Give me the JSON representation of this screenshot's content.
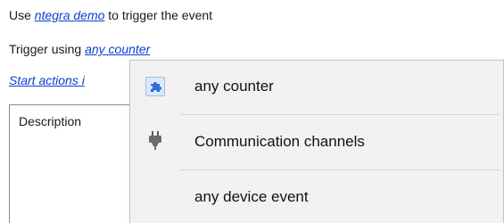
{
  "line1": {
    "prefix": "Use",
    "link": "ntegra demo",
    "suffix": "to trigger the event"
  },
  "line2": {
    "prefix": "Trigger using",
    "link": "any counter"
  },
  "line3": {
    "link": "Start actions i"
  },
  "description": {
    "label": "Description"
  },
  "menu": {
    "items": [
      {
        "label": "any counter",
        "icon": "puzzle-icon"
      },
      {
        "label": "Communication channels",
        "icon": "plug-icon"
      },
      {
        "label": "any device event",
        "icon": ""
      }
    ]
  },
  "colors": {
    "link": "#0b3ecf",
    "popup_bg": "#f2f2f2",
    "icon_highlight": "#dbe9fb",
    "puzzle": "#2f6fd6"
  }
}
